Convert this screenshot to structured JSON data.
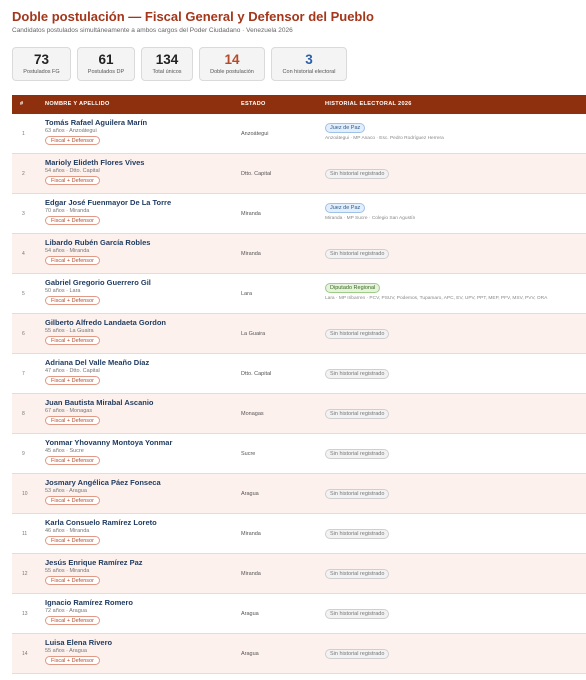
{
  "header": {
    "title": "Doble postulación — Fiscal General y Defensor del Pueblo",
    "subtitle": "Candidatos postulados simultáneamente a ambos cargos del Poder Ciudadano · Venezuela 2026"
  },
  "stats": [
    {
      "value": "73",
      "label": "Postulados FG"
    },
    {
      "value": "61",
      "label": "Postulados DP"
    },
    {
      "value": "134",
      "label": "Total únicos"
    },
    {
      "value": "14",
      "label": "Doble postulación"
    },
    {
      "value": "3",
      "label": "Con historial electoral"
    }
  ],
  "table": {
    "columns": [
      "#",
      "NOMBRE Y APELLIDO",
      "ESTADO",
      "HISTORIAL ELECTORAL 2026"
    ],
    "tag_label": "Fiscal + Defensor",
    "rows": [
      {
        "n": "1",
        "name": "Tomás Rafael Aguilera Marín",
        "meta": "63 años · Anzoátegui",
        "estado": "Anzoátegui",
        "historial": "Juez de Paz",
        "historial_detail": "Anzoátegui · MP Anaco · Esc. Pedro Rodríguez Herrera"
      },
      {
        "n": "2",
        "name": "Marioly Elideth Flores Vives",
        "meta": "54 años · Dtto. Capital",
        "estado": "Dtto. Capital",
        "historial": "Sin historial registrado",
        "historial_detail": ""
      },
      {
        "n": "3",
        "name": "Edgar José Fuenmayor De La Torre",
        "meta": "70 años · Miranda",
        "estado": "Miranda",
        "historial": "Juez de Paz",
        "historial_detail": "Miranda · MP Sucre · Colegio San Agustín"
      },
      {
        "n": "4",
        "name": "Libardo Rubén García Robles",
        "meta": "54 años · Miranda",
        "estado": "Miranda",
        "historial": "Sin historial registrado",
        "historial_detail": ""
      },
      {
        "n": "5",
        "name": "Gabriel Gregorio Guerrero Gil",
        "meta": "50 años · Lara",
        "estado": "Lara",
        "historial": "Diputado Regional",
        "historial_detail": "Lara · MP Iribarren · PCV, PSUV, Podemos, Tupamaro, APC, EV, UPV, PPT, MEP, PFV, MSV, PVV, ORA"
      },
      {
        "n": "6",
        "name": "Gilberto Alfredo Landaeta Gordon",
        "meta": "55 años · La Guaira",
        "estado": "La Guaira",
        "historial": "Sin historial registrado",
        "historial_detail": ""
      },
      {
        "n": "7",
        "name": "Adriana Del Valle Meaño Díaz",
        "meta": "47 años · Dtto. Capital",
        "estado": "Dtto. Capital",
        "historial": "Sin historial registrado",
        "historial_detail": ""
      },
      {
        "n": "8",
        "name": "Juan Bautista Mirabal Ascanio",
        "meta": "67 años · Monagas",
        "estado": "Monagas",
        "historial": "Sin historial registrado",
        "historial_detail": ""
      },
      {
        "n": "9",
        "name": "Yonmar Yhovanny Montoya Yonmar",
        "meta": "45 años · Sucre",
        "estado": "Sucre",
        "historial": "Sin historial registrado",
        "historial_detail": ""
      },
      {
        "n": "10",
        "name": "Josmary Angélica Páez Fonseca",
        "meta": "53 años · Aragua",
        "estado": "Aragua",
        "historial": "Sin historial registrado",
        "historial_detail": ""
      },
      {
        "n": "11",
        "name": "Karla Consuelo Ramírez Loreto",
        "meta": "46 años · Miranda",
        "estado": "Miranda",
        "historial": "Sin historial registrado",
        "historial_detail": ""
      },
      {
        "n": "12",
        "name": "Jesús Enrique Ramírez Paz",
        "meta": "55 años · Miranda",
        "estado": "Miranda",
        "historial": "Sin historial registrado",
        "historial_detail": ""
      },
      {
        "n": "13",
        "name": "Ignacio Ramírez Romero",
        "meta": "72 años · Aragua",
        "estado": "Aragua",
        "historial": "Sin historial registrado",
        "historial_detail": ""
      },
      {
        "n": "14",
        "name": "Luisa Elena Rivero",
        "meta": "55 años · Aragua",
        "estado": "Aragua",
        "historial": "Sin historial registrado",
        "historial_detail": ""
      }
    ]
  },
  "colors": {
    "title": "#a3361b",
    "table_header": "#8e2f0e",
    "name": "#1e3a5f",
    "tag": "#b84a2c",
    "doble_stat": "#b54a2a",
    "historial_stat": "#2b5fa8"
  }
}
